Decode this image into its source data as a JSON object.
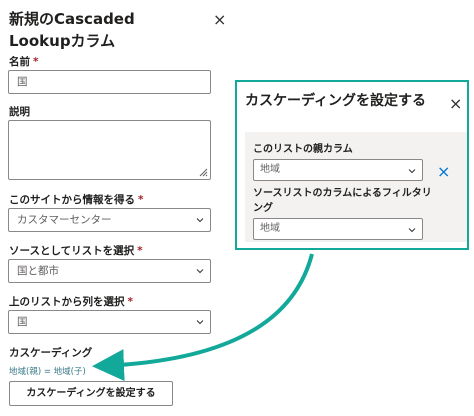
{
  "panel": {
    "title": "新規のCascaded Lookupカラム",
    "close_icon": "×",
    "name_label": "名前",
    "name_value": "国",
    "description_label": "説明",
    "description_value": "",
    "site_label": "このサイトから情報を得る",
    "site_value": "カスタマーセンター",
    "source_list_label": "ソースとしてリストを選択",
    "source_list_value": "国と都市",
    "upper_column_label": "上のリストから列を選択",
    "upper_column_value": "国",
    "cascading_label": "カスケーディング",
    "cascading_value": "地域(親) = 地域(子)",
    "set_cascading_button": "カスケーディングを設定する",
    "required_mark": "*"
  },
  "dialog": {
    "title": "カスケーディングを設定する",
    "close_icon": "×",
    "parent_column_label": "このリストの親カラム",
    "parent_column_value": "地域",
    "filter_label": "ソースリストのカラムによるフィルタリング",
    "filter_value": "地域",
    "remove_icon": "×"
  },
  "colors": {
    "accent_teal": "#12a89a",
    "required_red": "#a4262c",
    "link_blue": "#0078d4"
  }
}
